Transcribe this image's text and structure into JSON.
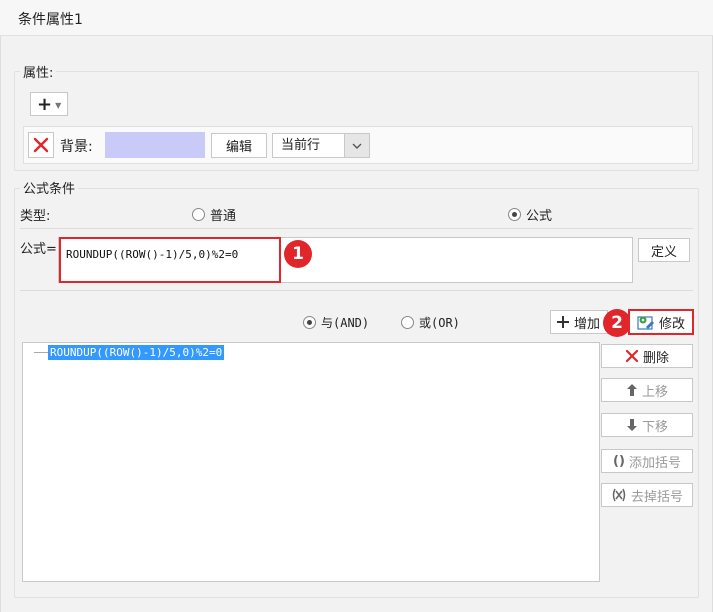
{
  "window": {
    "title": "条件属性1"
  },
  "property": {
    "group_label": "属性:",
    "add_symbol": "+",
    "row": {
      "label": "背景:",
      "swatch_color": "#c9caf7",
      "edit_label": "编辑",
      "scope_value": "当前行"
    }
  },
  "formula_condition": {
    "group_label": "公式条件",
    "type_label": "类型:",
    "type_options": {
      "normal": "普通",
      "formula": "公式"
    },
    "selected_type": "formula",
    "formula_label": "公式=",
    "formula_value": "ROUNDUP((ROW()-1)/5,0)%2=0",
    "define_label": "定义",
    "logic": {
      "and_label": "与(AND)",
      "or_label": "或(OR)",
      "selected": "and"
    },
    "buttons": {
      "add": "增加",
      "modify": "修改",
      "delete": "删除",
      "move_up": "上移",
      "move_down": "下移",
      "add_paren": "添加括号",
      "remove_paren": "去掉括号"
    },
    "conditions": [
      "ROUNDUP((ROW()-1)/5,0)%2=0"
    ]
  },
  "annotations": {
    "badge1": "1",
    "badge2": "2"
  },
  "colors": {
    "accent_red": "#e0262b",
    "selection_blue": "#3399ff"
  }
}
